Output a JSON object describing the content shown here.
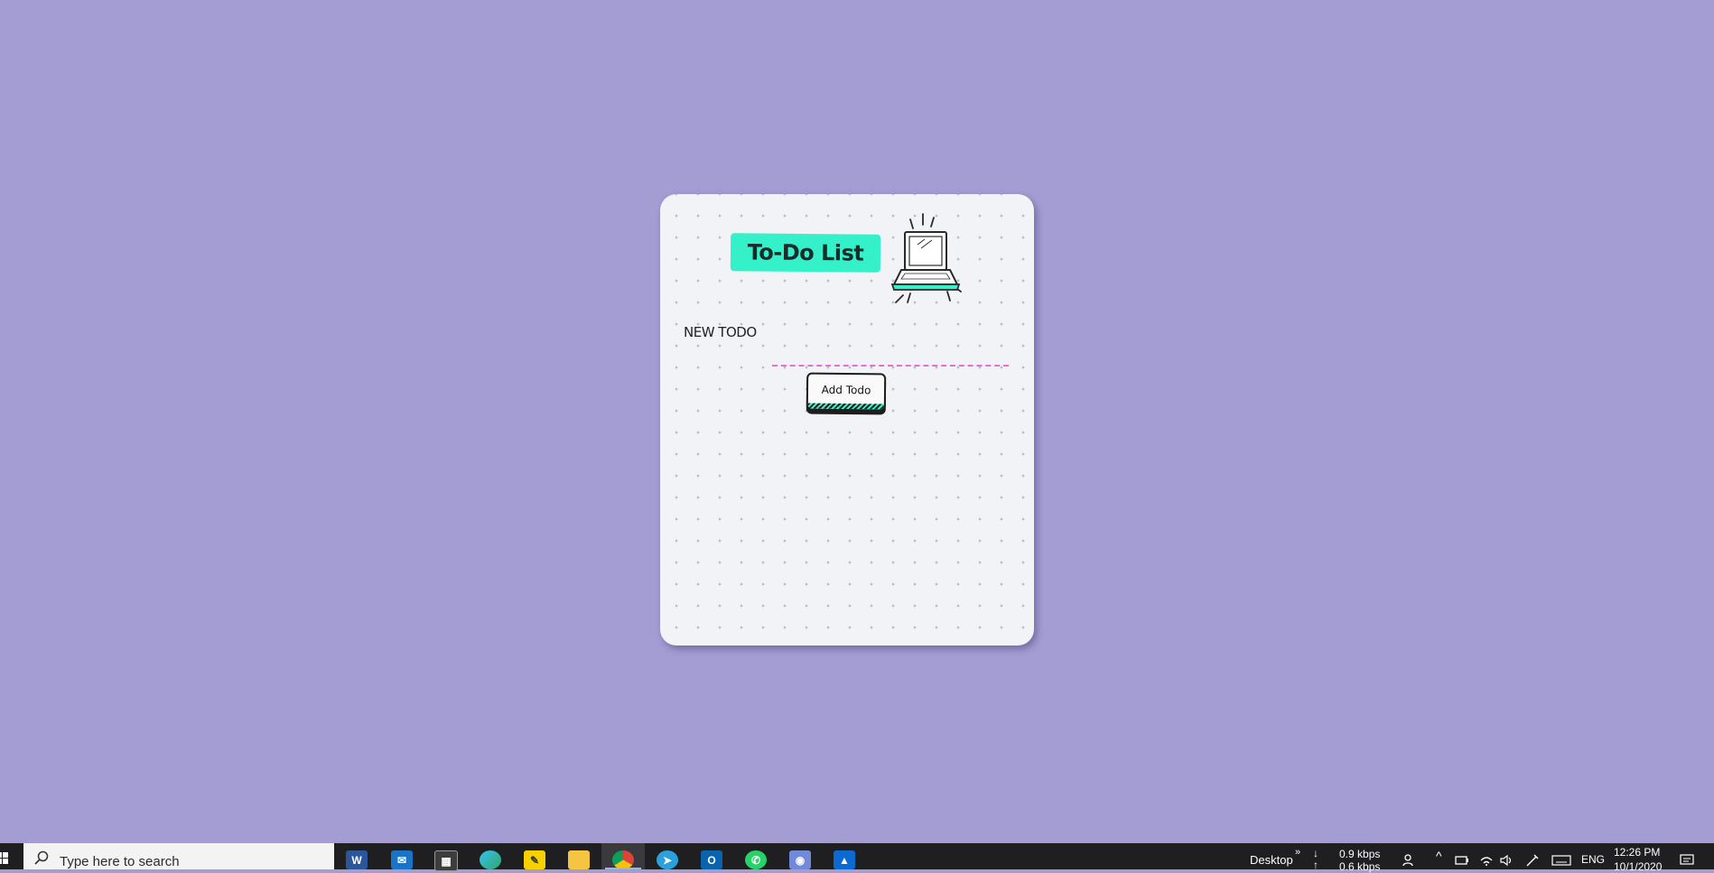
{
  "app": {
    "title": "To-Do List",
    "new_todo_label": "NEW TODO",
    "new_todo_value": "",
    "add_button_label": "Add Todo"
  },
  "colors": {
    "background": "#a39dd3",
    "card": "#f1f3f6",
    "title_accent": "#34f1c9",
    "input_underline": "#e46fdc"
  },
  "taskbar": {
    "search_placeholder": "Type here to search",
    "pinned_apps": [
      {
        "icon": "word-icon"
      },
      {
        "icon": "mail-icon"
      },
      {
        "icon": "store-icon"
      },
      {
        "icon": "edge-icon"
      },
      {
        "icon": "sticky-notes-icon"
      },
      {
        "icon": "file-explorer-icon"
      },
      {
        "icon": "chrome-icon",
        "active": true
      },
      {
        "icon": "telegram-icon"
      },
      {
        "icon": "outlook-icon"
      },
      {
        "icon": "whatsapp-icon"
      },
      {
        "icon": "discord-icon"
      },
      {
        "icon": "photos-icon"
      }
    ],
    "desktop_label": "Desktop",
    "net_down": "0.9 kbps",
    "net_up": "0.6 kbps",
    "language": "ENG",
    "time": "12:26 PM",
    "date": "10/1/2020"
  }
}
